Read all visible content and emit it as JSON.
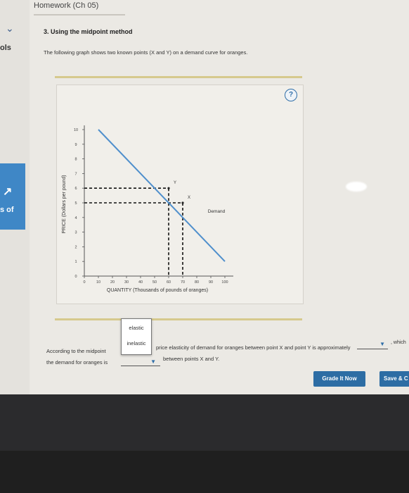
{
  "header": {
    "title": "Homework (Ch 05)"
  },
  "sidebar": {
    "chevron_icon": "chevron-down-icon",
    "tools_label": "ols",
    "panel_label": "s of",
    "panel_icon": "chart-icon"
  },
  "question": {
    "title": "3. Using the midpoint method",
    "prompt": "The following graph shows two known points (X and Y) on a demand curve for oranges."
  },
  "graph": {
    "help_label": "?",
    "ylabel": "PRICE (Dollars per pound)",
    "xlabel": "QUANTITY (Thousands of pounds of oranges)",
    "demand_label": "Demand",
    "point_x_label": "X",
    "point_y_label": "Y"
  },
  "chart_data": {
    "type": "line",
    "xlim": [
      0,
      100
    ],
    "ylim": [
      0,
      10
    ],
    "x_ticks": [
      0,
      10,
      20,
      30,
      40,
      50,
      60,
      70,
      80,
      90,
      100
    ],
    "x_tick_labels": [
      "0",
      "10",
      "20",
      "30",
      "40",
      "50",
      "60",
      "70",
      "80",
      "90",
      "100"
    ],
    "y_ticks": [
      0,
      1,
      2,
      3,
      4,
      5,
      6,
      7,
      8,
      9,
      10
    ],
    "y_tick_labels": [
      "0",
      "1",
      "2",
      "3",
      "4",
      "5",
      "6",
      "7",
      "8",
      "9",
      "10"
    ],
    "series": [
      {
        "name": "Demand",
        "x": [
          10,
          100
        ],
        "y": [
          10,
          1
        ]
      }
    ],
    "points": [
      {
        "label": "Y",
        "x": 60,
        "y": 6
      },
      {
        "label": "X",
        "x": 70,
        "y": 5
      }
    ],
    "dashed_guides": true,
    "colors": {
      "demand": "#4f8fcc",
      "guides": "#111111"
    }
  },
  "answer": {
    "line1_prefix": "According to the midpoint",
    "line1_suffix": "price elasticity of demand for oranges between point X and point Y is approximately",
    "line1_end": ", which",
    "line2_prefix": "the demand for oranges is",
    "line2_suffix": "between points X and Y.",
    "dropdown_options": [
      "elastic",
      "inelastic"
    ]
  },
  "buttons": {
    "grade": "Grade It Now",
    "save": "Save & C"
  }
}
